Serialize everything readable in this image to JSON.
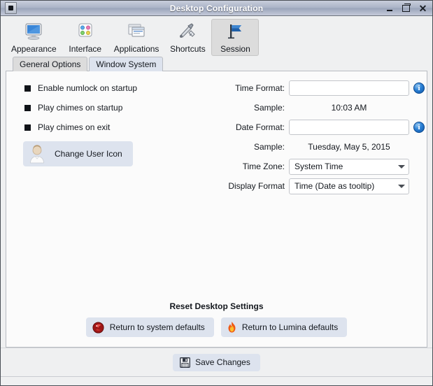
{
  "window": {
    "title": "Desktop Configuration",
    "app_icon": "app-window-icon",
    "minimize_label": "",
    "maximize_label": "",
    "close_label": "✕"
  },
  "toolbar": {
    "items": [
      {
        "label": "Appearance",
        "icon": "monitor-icon",
        "selected": false
      },
      {
        "label": "Interface",
        "icon": "dots-grid-icon",
        "selected": false
      },
      {
        "label": "Applications",
        "icon": "windows-stack-icon",
        "selected": false
      },
      {
        "label": "Shortcuts",
        "icon": "wrench-screwdriver-icon",
        "selected": false
      },
      {
        "label": "Session",
        "icon": "flag-icon",
        "selected": true
      }
    ]
  },
  "tabs": [
    {
      "label": "General Options",
      "active": true
    },
    {
      "label": "Window System",
      "active": false
    }
  ],
  "options": {
    "checkboxes": [
      {
        "label": "Enable numlock on startup",
        "checked": true
      },
      {
        "label": "Play chimes on startup",
        "checked": true
      },
      {
        "label": "Play chimes on exit",
        "checked": true
      }
    ],
    "change_user_icon_button": {
      "label": "Change User Icon",
      "icon": "user-avatar-icon"
    }
  },
  "form": {
    "time_format": {
      "label": "Time Format:",
      "value": "",
      "placeholder": "",
      "info_icon": "info-icon"
    },
    "time_sample": {
      "label": "Sample:",
      "value": "10:03 AM"
    },
    "date_format": {
      "label": "Date Format:",
      "value": "",
      "placeholder": "",
      "info_icon": "info-icon"
    },
    "date_sample": {
      "label": "Sample:",
      "value": "Tuesday, May 5, 2015"
    },
    "time_zone": {
      "label": "Time Zone:",
      "value": "System Time"
    },
    "display_format": {
      "label": "Display Format",
      "value": "Time (Date as tooltip)"
    }
  },
  "reset": {
    "title": "Reset Desktop Settings",
    "system_button": {
      "label": "Return to system defaults",
      "icon": "beastie-logo-icon"
    },
    "lumina_button": {
      "label": "Return to Lumina defaults",
      "icon": "flame-icon"
    }
  },
  "footer": {
    "save_button": {
      "label": "Save Changes",
      "icon": "floppy-save-icon"
    }
  },
  "colors": {
    "titlebar_accent": "#9aa4ba",
    "button_blue": "#dde3ee",
    "selected_tab": "#dcdcdc",
    "info_blue": "#2a7fd4",
    "flame_orange": "#f07818",
    "beastie_red": "#a81c1c"
  }
}
